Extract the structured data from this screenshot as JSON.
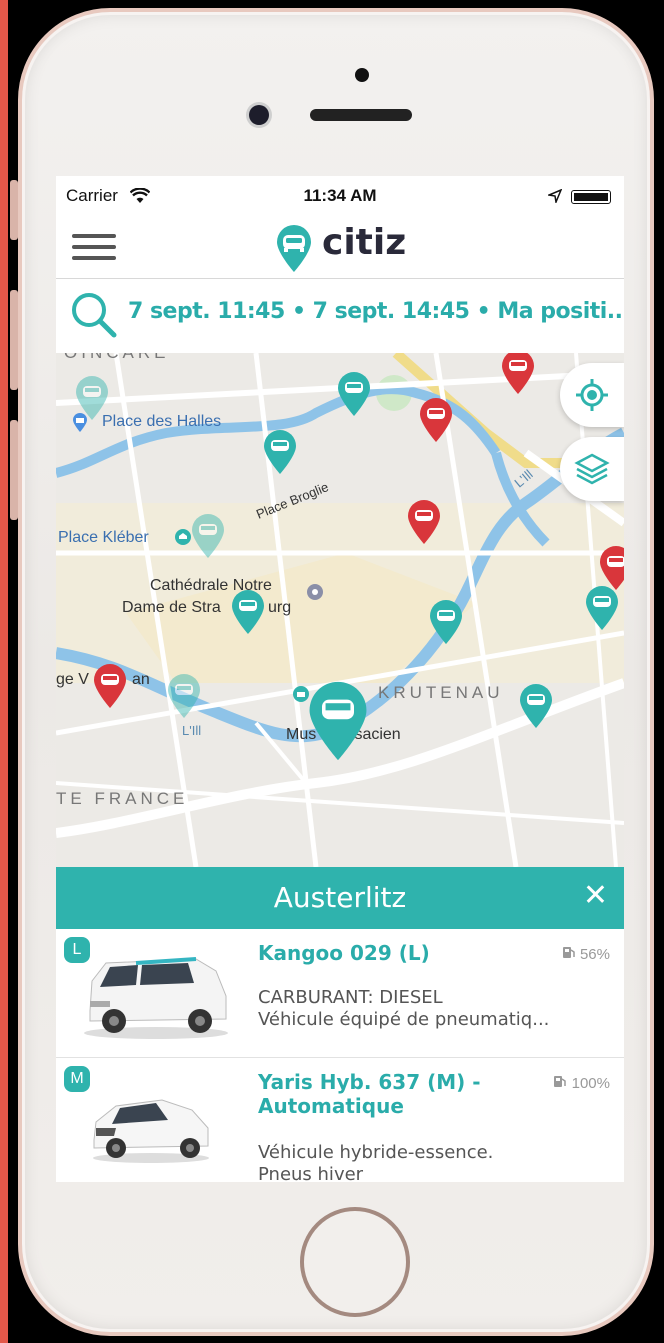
{
  "status_bar": {
    "carrier": "Carrier",
    "time": "11:34 AM"
  },
  "app": {
    "name": "citiz",
    "brand_color": "#2fb3ad"
  },
  "search": {
    "summary": "7 sept. 11:45 • 7 sept. 14:45 • Ma positi..."
  },
  "map": {
    "labels": {
      "place_des_halles": "Place des Halles",
      "place_kleber": "Place Kléber",
      "place_broglie": "Place Broglie",
      "cathedrale_1": "Cathédrale Notre",
      "cathedrale_2": "Dame de Stra",
      "cathedrale_3": "urg",
      "krutenau": "KRUTENAU",
      "musee_1": "Mus",
      "musee_2": "Isacien",
      "lill_1": "L'Ill",
      "lill_2": "L'Ill",
      "france": "TE FRANCE",
      "ge_v": "ge V",
      "an": "an",
      "poincare": "OINCARE"
    },
    "pin_colors": {
      "available": "#2fb3ad",
      "unavailable": "#d9363b"
    }
  },
  "station_panel": {
    "title": "Austerlitz",
    "close_icon": "close-icon",
    "vehicles": [
      {
        "category": "L",
        "name": "Kangoo 029 (L)",
        "fuel": "56%",
        "desc_line1": "CARBURANT: DIESEL",
        "desc_line2": "Véhicule équipé de pneumatiq..."
      },
      {
        "category": "M",
        "name": "Yaris Hyb. 637 (M) - Automatique",
        "fuel": "100%",
        "desc_line1": "Véhicule hybride-essence.",
        "desc_line2": "Pneus hiver"
      }
    ]
  }
}
